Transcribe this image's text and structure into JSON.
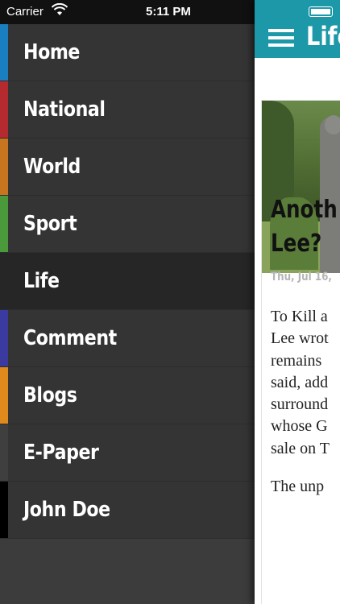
{
  "status_bar": {
    "carrier": "Carrier",
    "time": "5:11 PM"
  },
  "menu": {
    "items": [
      {
        "label": "Home",
        "color": "#1a7fc0"
      },
      {
        "label": "National",
        "color": "#b52a2e"
      },
      {
        "label": "World",
        "color": "#c9741f"
      },
      {
        "label": "Sport",
        "color": "#4a9a3c"
      },
      {
        "label": "Life",
        "color": "#262626",
        "active": true
      },
      {
        "label": "Comment",
        "color": "#3a3aa0"
      },
      {
        "label": "Blogs",
        "color": "#e08a1c"
      },
      {
        "label": "E-Paper",
        "color": "#3f3f3f"
      },
      {
        "label": "John Doe",
        "color": "#000000"
      }
    ]
  },
  "content": {
    "nav_title": "Life",
    "article": {
      "headline_1": "Anoth",
      "headline_2": "Lee?",
      "date": "Thu, Jul 16,",
      "body_lines": [
        "To Kill a",
        "Lee wrot",
        "remains",
        "said, add",
        "surround",
        "whose G",
        "sale on T"
      ],
      "body_next": "The unp"
    }
  },
  "colors": {
    "nav_bar": "#1d98a8",
    "menu_bg": "#343434",
    "menu_active": "#262626"
  }
}
